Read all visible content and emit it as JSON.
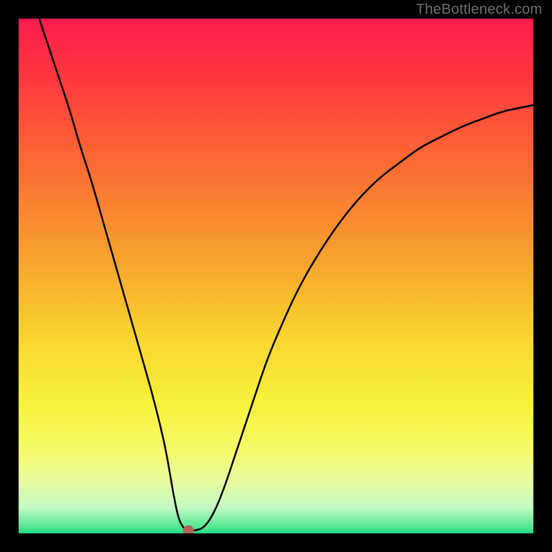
{
  "watermark": "TheBottleneck.com",
  "chart_data": {
    "type": "line",
    "title": "",
    "xlabel": "",
    "ylabel": "",
    "xlim": [
      0,
      100
    ],
    "ylim": [
      0,
      100
    ],
    "grid": false,
    "legend": false,
    "series": [
      {
        "name": "bottleneck-curve",
        "x": [
          4,
          6,
          8,
          10,
          12,
          14,
          16,
          18,
          20,
          22,
          24,
          26,
          28,
          29,
          30,
          31,
          32,
          33,
          34,
          36,
          38,
          40,
          42,
          44,
          46,
          48,
          50,
          54,
          58,
          62,
          66,
          70,
          74,
          78,
          82,
          86,
          90,
          94,
          98,
          100
        ],
        "y": [
          100,
          94,
          88,
          82,
          75,
          69,
          62,
          55,
          48,
          41,
          34,
          27,
          19,
          14,
          8,
          3,
          1,
          0.5,
          0.5,
          1,
          4,
          9,
          15,
          21,
          27,
          33,
          38,
          47,
          54,
          60,
          65,
          69,
          72,
          75,
          77,
          79,
          80.5,
          82,
          82.8,
          83.2
        ]
      }
    ],
    "marker": {
      "name": "optimal-marker",
      "x": 33,
      "y": 0.5,
      "color": "#b5625a"
    },
    "gradient_stops": [
      {
        "offset": 0.0,
        "color": "#ff1b4d"
      },
      {
        "offset": 0.12,
        "color": "#ff3a3f"
      },
      {
        "offset": 0.3,
        "color": "#fb7033"
      },
      {
        "offset": 0.48,
        "color": "#f7a62d"
      },
      {
        "offset": 0.62,
        "color": "#f9d52f"
      },
      {
        "offset": 0.75,
        "color": "#f7f33b"
      },
      {
        "offset": 0.84,
        "color": "#f4fb6a"
      },
      {
        "offset": 0.9,
        "color": "#e8fba1"
      },
      {
        "offset": 0.95,
        "color": "#c3f9c2"
      },
      {
        "offset": 0.99,
        "color": "#4be690"
      },
      {
        "offset": 1.0,
        "color": "#18db87"
      }
    ]
  }
}
